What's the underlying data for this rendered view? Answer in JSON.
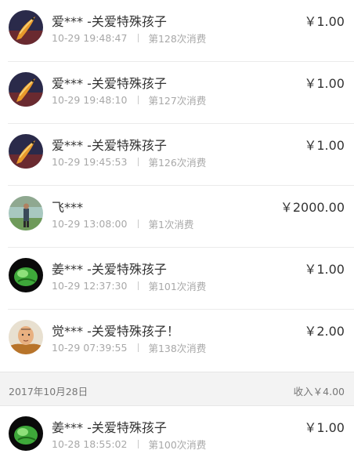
{
  "donations": [
    {
      "name": "爱*** -关爱特殊孩子",
      "time": "10-29 19:48:47",
      "count": "第128次消费",
      "amount": "￥1.00",
      "avatar": "koi-fish-avatar"
    },
    {
      "name": "爱*** -关爱特殊孩子",
      "time": "10-29 19:48:10",
      "count": "第127次消费",
      "amount": "￥1.00",
      "avatar": "koi-fish-avatar"
    },
    {
      "name": "爱*** -关爱特殊孩子",
      "time": "10-29 19:45:53",
      "count": "第126次消费",
      "amount": "￥1.00",
      "avatar": "koi-fish-avatar"
    },
    {
      "name": "飞***",
      "time": "10-29 13:08:00",
      "count": "第1次消费",
      "amount": "￥2000.00",
      "avatar": "person-outdoor-avatar"
    },
    {
      "name": "姜*** -关爱特殊孩子",
      "time": "10-29 12:37:30",
      "count": "第101次消费",
      "amount": "￥1.00",
      "avatar": "green-leaf-avatar"
    },
    {
      "name": "觉*** -关爱特殊孩子！",
      "time": "10-29 07:39:55",
      "count": "第138次消费",
      "amount": "￥2.00",
      "avatar": "monk-avatar"
    }
  ],
  "date_group": {
    "date": "2017年10月28日",
    "income": "收入￥4.00"
  },
  "donations_after": [
    {
      "name": "姜*** -关爱特殊孩子",
      "time": "10-28 18:55:02",
      "count": "第100次消费",
      "amount": "￥1.00",
      "avatar": "green-leaf-avatar"
    }
  ]
}
